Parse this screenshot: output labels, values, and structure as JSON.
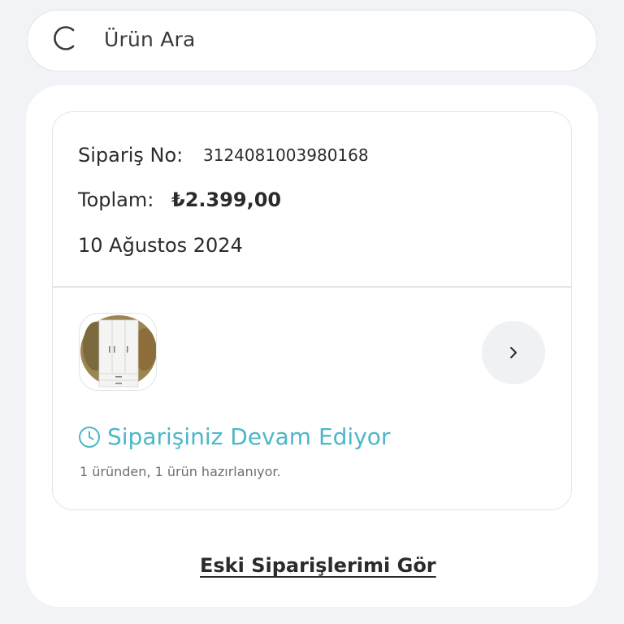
{
  "search": {
    "icon": "search-icon",
    "placeholder": "Ürün Ara"
  },
  "order": {
    "order_no_label": "Sipariş No:",
    "order_no_value": "3124081003980168",
    "total_label": "Toplam:",
    "total_value": "₺2.399,00",
    "date": "10 Ağustos 2024",
    "product_image": "white-wardrobe-thumbnail",
    "details_icon": "chevron-right-icon",
    "status_icon": "clock-icon",
    "status_text": "Siparişiniz Devam Ediyor",
    "status_sub": "1 üründen, 1 ürün hazırlanıyor."
  },
  "old_orders_link": "Eski Siparişlerimi Gör",
  "colors": {
    "background": "#f2f3f7",
    "card": "#ffffff",
    "border": "#e3e4e8",
    "status_accent": "#4cb7c8",
    "text": "#2b2b2b"
  }
}
